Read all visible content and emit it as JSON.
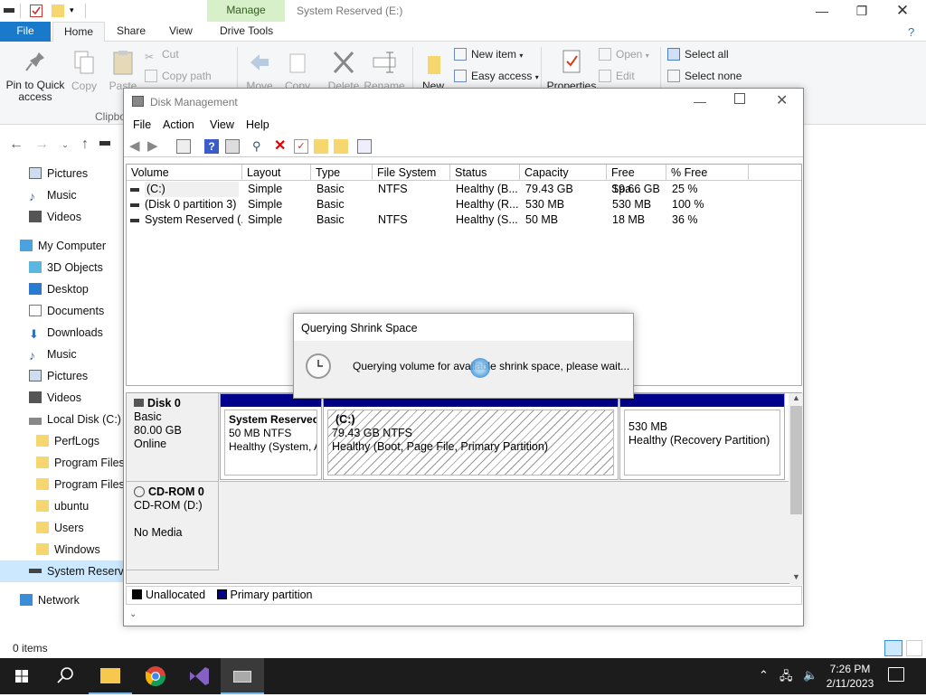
{
  "explorer": {
    "window_title": "System Reserved (E:)",
    "manage_tab": "Manage",
    "tabs": [
      "File",
      "Home",
      "Share",
      "View",
      "Drive Tools"
    ],
    "ribbon": {
      "pin_label": "Pin to Quick access",
      "copy_label": "Copy",
      "paste_label": "Paste",
      "cut_label": "Cut",
      "copy_path_label": "Copy path",
      "clipboard_group": "Clipbo",
      "move_label": "Move",
      "copy_to_label": "Copy",
      "delete_label": "Delete",
      "rename_label": "Rename",
      "new_label": "New",
      "new_item_label": "New item",
      "easy_access_label": "Easy access",
      "properties_label": "Properties",
      "open_label": "Open",
      "edit_label": "Edit",
      "select_all_label": "Select all",
      "select_none_label": "Select none"
    },
    "nav_items": [
      {
        "label": "Pictures",
        "icon": "pictures-icon"
      },
      {
        "label": "Music",
        "icon": "music-icon"
      },
      {
        "label": "Videos",
        "icon": "videos-icon"
      },
      {
        "label": "My Computer",
        "icon": "computer-icon"
      },
      {
        "label": "3D Objects",
        "icon": "3d-objects-icon"
      },
      {
        "label": "Desktop",
        "icon": "desktop-icon"
      },
      {
        "label": "Documents",
        "icon": "documents-icon"
      },
      {
        "label": "Downloads",
        "icon": "downloads-icon"
      },
      {
        "label": "Music",
        "icon": "music-icon"
      },
      {
        "label": "Pictures",
        "icon": "pictures-icon"
      },
      {
        "label": "Videos",
        "icon": "videos-icon"
      },
      {
        "label": "Local Disk (C:)",
        "icon": "drive-icon"
      },
      {
        "label": "PerfLogs",
        "icon": "folder-icon"
      },
      {
        "label": "Program Files",
        "icon": "folder-icon"
      },
      {
        "label": "Program Files",
        "icon": "folder-icon"
      },
      {
        "label": "ubuntu",
        "icon": "folder-icon"
      },
      {
        "label": "Users",
        "icon": "folder-icon"
      },
      {
        "label": "Windows",
        "icon": "folder-icon"
      },
      {
        "label": "System Reserved",
        "icon": "drive-icon"
      },
      {
        "label": "Network",
        "icon": "network-icon"
      }
    ],
    "status": "0 items"
  },
  "disk_mgmt": {
    "title": "Disk Management",
    "menu": [
      "File",
      "Action",
      "View",
      "Help"
    ],
    "columns": [
      "Volume",
      "Layout",
      "Type",
      "File System",
      "Status",
      "Capacity",
      "Free Spa...",
      "% Free"
    ],
    "volumes": [
      [
        "(C:)",
        "Simple",
        "Basic",
        "NTFS",
        "Healthy (B...",
        "79.43 GB",
        "19.66 GB",
        "25 %"
      ],
      [
        "(Disk 0 partition 3)",
        "Simple",
        "Basic",
        "",
        "Healthy (R...",
        "530 MB",
        "530 MB",
        "100 %"
      ],
      [
        "System Reserved (...",
        "Simple",
        "Basic",
        "NTFS",
        "Healthy (S...",
        "50 MB",
        "18 MB",
        "36 %"
      ]
    ],
    "disk0": {
      "name": "Disk 0",
      "type": "Basic",
      "size": "80.00 GB",
      "state": "Online",
      "partitions": [
        {
          "name": "System Reserved",
          "size": "50 MB NTFS",
          "status": "Healthy (System, A"
        },
        {
          "name": "(C:)",
          "size": "79.43 GB NTFS",
          "status": "Healthy (Boot, Page File, Primary Partition)"
        },
        {
          "name": "",
          "size": "530 MB",
          "status": "Healthy (Recovery Partition)"
        }
      ]
    },
    "cdrom": {
      "name": "CD-ROM 0",
      "type": "CD-ROM (D:)",
      "state": "No Media"
    },
    "legend": {
      "unallocated": "Unallocated",
      "primary": "Primary partition"
    }
  },
  "dialog": {
    "title": "Querying Shrink Space",
    "message": "Querying volume for available shrink space, please wait..."
  },
  "taskbar": {
    "time": "7:26 PM",
    "date": "2/11/2023"
  },
  "colors": {
    "primary_partition": "#00008b",
    "file_tab": "#1979ca",
    "manage_tab": "#d7f0c9",
    "taskbar": "#1c1c1c"
  }
}
